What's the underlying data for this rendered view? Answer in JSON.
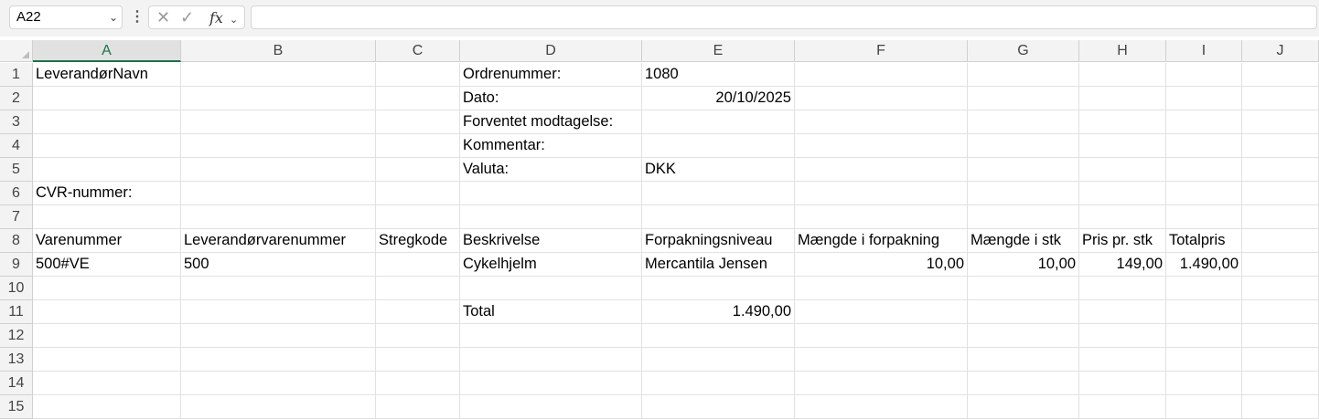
{
  "formula_bar": {
    "name_box": "A22",
    "fx_label": "fx",
    "formula": ""
  },
  "columns": [
    "A",
    "B",
    "C",
    "D",
    "E",
    "F",
    "G",
    "H",
    "I",
    "J"
  ],
  "selected_column": "A",
  "rows": [
    [
      "LeverandørNavn",
      "",
      "",
      "Ordrenummer:",
      "1080",
      "",
      "",
      "",
      "",
      ""
    ],
    [
      "",
      "",
      "",
      "Dato:",
      "20/10/2025",
      "",
      "",
      "",
      "",
      ""
    ],
    [
      "",
      "",
      "",
      "Forventet modtagelse:",
      "",
      "",
      "",
      "",
      "",
      ""
    ],
    [
      "",
      "",
      "",
      "Kommentar:",
      "",
      "",
      "",
      "",
      "",
      ""
    ],
    [
      "",
      "",
      "",
      "Valuta:",
      "DKK",
      "",
      "",
      "",
      "",
      ""
    ],
    [
      "CVR-nummer:",
      "",
      "",
      "",
      "",
      "",
      "",
      "",
      "",
      ""
    ],
    [
      "",
      "",
      "",
      "",
      "",
      "",
      "",
      "",
      "",
      ""
    ],
    [
      "Varenummer",
      "Leverandørvarenummer",
      "Stregkode",
      "Beskrivelse",
      "Forpakningsniveau",
      "Mængde i forpakning",
      "Mængde i stk",
      "Pris pr. stk",
      "Totalpris",
      ""
    ],
    [
      "500#VE",
      "500",
      "",
      "Cykelhjelm",
      "Mercantila Jensen",
      "10,00",
      "10,00",
      "149,00",
      "1.490,00",
      ""
    ],
    [
      "",
      "",
      "",
      "",
      "",
      "",
      "",
      "",
      "",
      ""
    ],
    [
      "",
      "",
      "",
      "Total",
      "1.490,00",
      "",
      "",
      "",
      "",
      ""
    ],
    [
      "",
      "",
      "",
      "",
      "",
      "",
      "",
      "",
      "",
      ""
    ],
    [
      "",
      "",
      "",
      "",
      "",
      "",
      "",
      "",
      "",
      ""
    ],
    [
      "",
      "",
      "",
      "",
      "",
      "",
      "",
      "",
      "",
      ""
    ],
    [
      "",
      "",
      "",
      "",
      "",
      "",
      "",
      "",
      "",
      ""
    ]
  ],
  "right_aligned": [
    [
      1,
      4
    ],
    [
      8,
      5
    ],
    [
      8,
      6
    ],
    [
      8,
      7
    ],
    [
      8,
      8
    ],
    [
      10,
      4
    ]
  ]
}
